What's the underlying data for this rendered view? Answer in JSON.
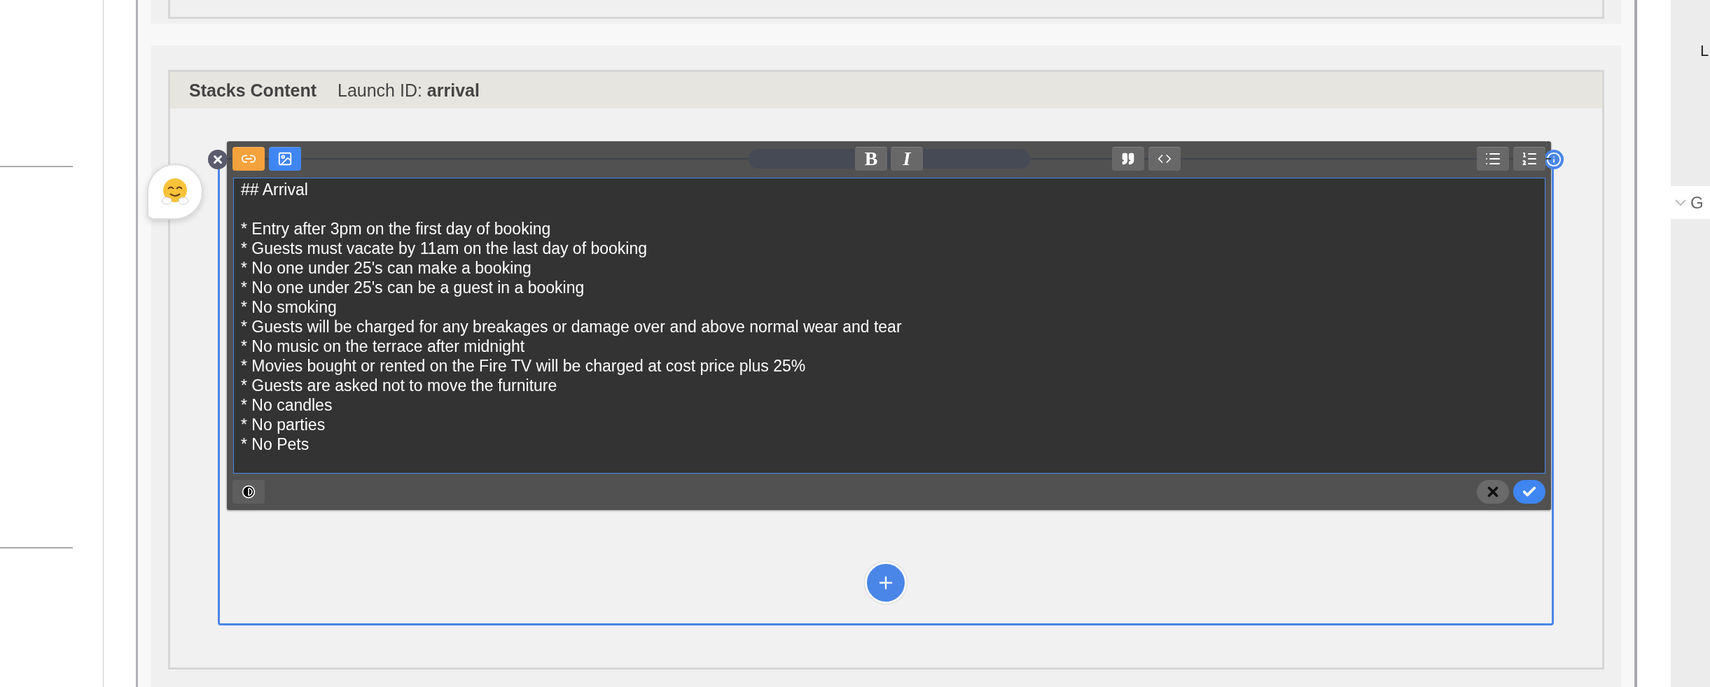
{
  "panel": {
    "title": "Stacks Content",
    "launch_label": "Launch ID:",
    "launch_id": "arrival"
  },
  "editor": {
    "toolbar": {
      "insert": [
        {
          "kind": "link",
          "color": "#f4a23c"
        },
        {
          "kind": "image",
          "color": "#3f86f2"
        }
      ],
      "format": [
        {
          "kind": "bold",
          "label": "B"
        },
        {
          "kind": "italic",
          "label": "I"
        }
      ],
      "blocks": [
        {
          "kind": "quote"
        },
        {
          "kind": "code"
        }
      ],
      "lists": [
        {
          "kind": "bullet_list"
        },
        {
          "kind": "numbered_list"
        }
      ]
    },
    "content": "## Arrival\n\n* Entry after 3pm on the first day of booking\n* Guests must vacate by 11am on the last day of booking\n* No one under 25's can make a booking\n* No one under 25's can be a guest in a booking\n* No smoking\n* Guests will be charged for any breakages or damage over and above normal wear and tear\n* No music on the terrace after midnight\n* Movies bought or rented on the Fire TV will be charged at cost price plus 25%\n* Guests are asked not to move the furniture\n* No candles\n* No parties\n* No Pets",
    "footer": {
      "left": [
        {
          "kind": "contrast"
        }
      ],
      "right": [
        {
          "kind": "cancel"
        },
        {
          "kind": "confirm"
        }
      ]
    }
  },
  "right_panel": {
    "label": "L",
    "group": {
      "label": "G",
      "expanded": true
    }
  }
}
